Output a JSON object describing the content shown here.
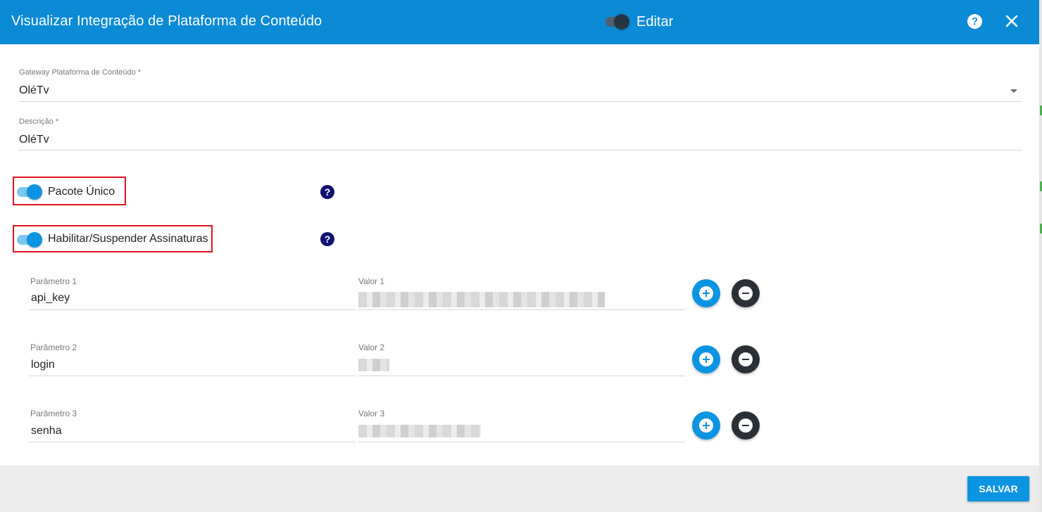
{
  "dialog": {
    "title": "Visualizar Integração de Plataforma de Conteúdo",
    "edit_label": "Editar",
    "help_icon": "?",
    "close_icon": "close-icon"
  },
  "gateway": {
    "label": "Gateway Plataforma de Conteúdo *",
    "value": "OléTv"
  },
  "descricao": {
    "label": "Descrição *",
    "value": "OléTv"
  },
  "toggles": {
    "pacote_unico": {
      "label": "Pacote Único",
      "on": true
    },
    "habilitar": {
      "label": "Habilitar/Suspender Assinaturas",
      "on": true
    },
    "help_glyph": "?"
  },
  "params": [
    {
      "param_label": "Parâmetro 1",
      "param_value": "api_key",
      "valor_label": "Valor 1"
    },
    {
      "param_label": "Parâmetro 2",
      "param_value": "login",
      "valor_label": "Valor 2"
    },
    {
      "param_label": "Parâmetro 3",
      "param_value": "senha",
      "valor_label": "Valor 3"
    }
  ],
  "footer": {
    "save_label": "SALVAR"
  },
  "colors": {
    "header": "#0b8ad6",
    "accent": "#0b94e2",
    "highlight_border": "#e0141e",
    "help_icon": "#101070"
  }
}
